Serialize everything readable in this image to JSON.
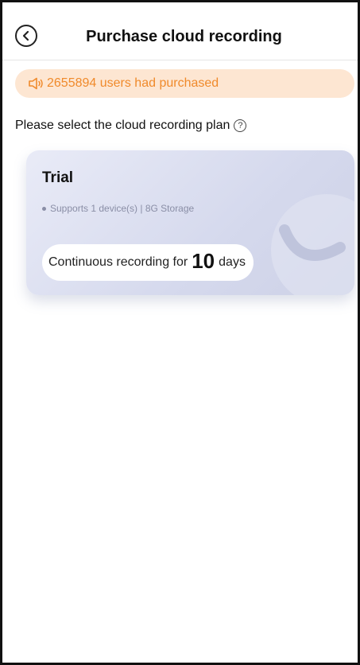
{
  "header": {
    "title": "Purchase cloud recording",
    "back_icon": "chevron-left-icon"
  },
  "notice": {
    "icon": "speaker-icon",
    "text": "2655894 users had purchased",
    "color": "#f08a2b",
    "background": "#fde6d2"
  },
  "section": {
    "label": "Please select the cloud recording plan",
    "help_icon": "question-circle-icon",
    "help_glyph": "?"
  },
  "plans": [
    {
      "name": "Trial",
      "features": "Supports 1 device(s) | 8G Storage",
      "duration_prefix": "Continuous recording for",
      "duration_value": "10",
      "duration_unit": "days"
    }
  ]
}
